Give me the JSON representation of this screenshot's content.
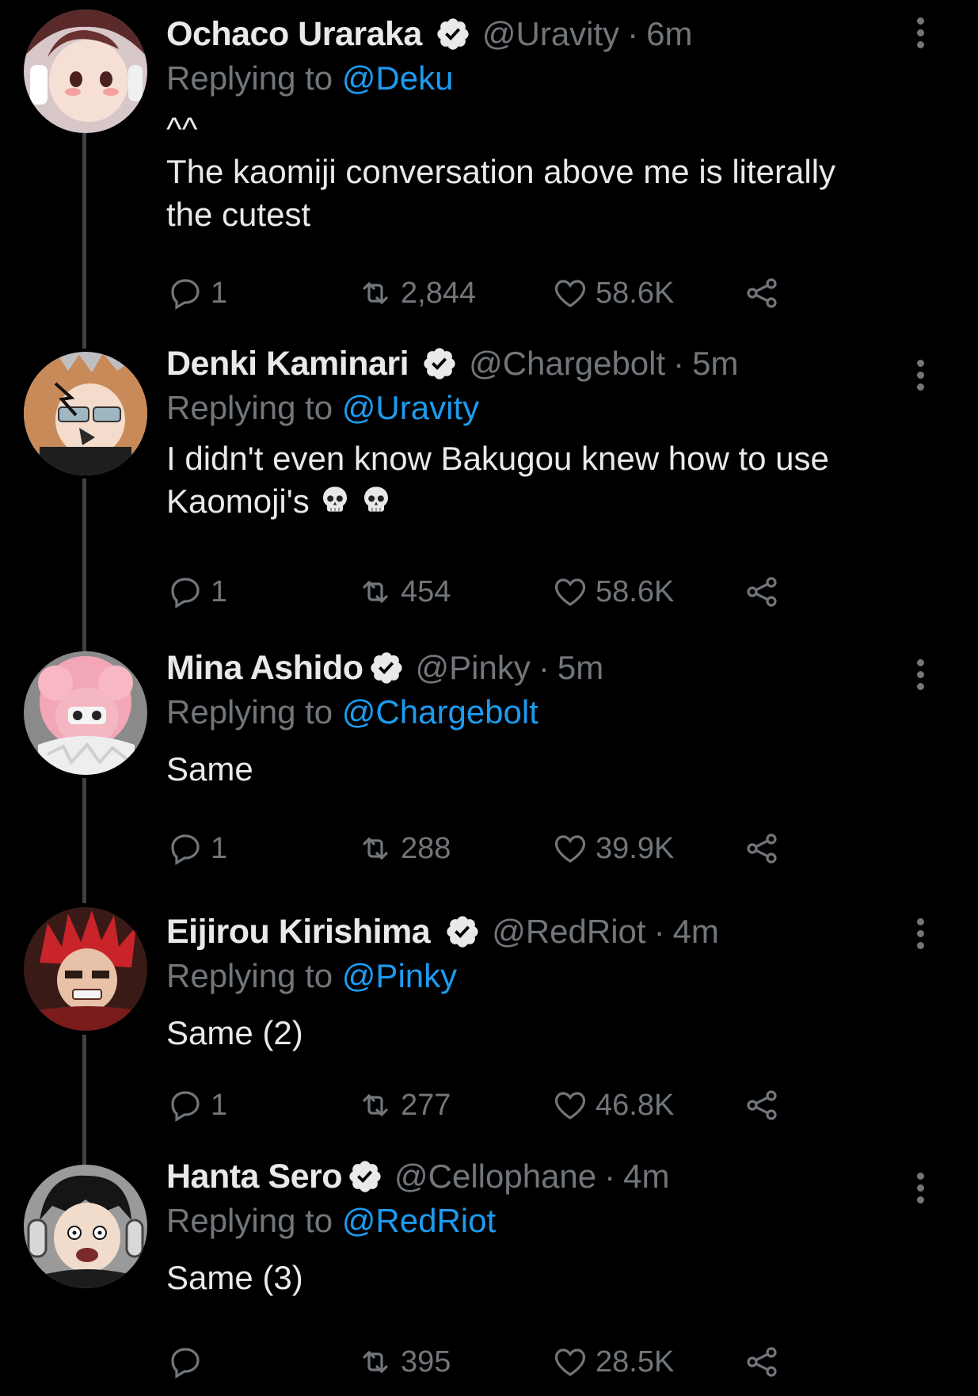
{
  "tweets": [
    {
      "name": "Ochaco Uraraka",
      "handle": "@Uravity",
      "separator": "·",
      "time": "6m",
      "replying_prefix": "Replying to ",
      "replying_to": "@Deku",
      "text_lines": [
        "^^",
        "The kaomiji conversation above me is literally",
        "the cutest"
      ],
      "replies": "1",
      "retweets": "2,844",
      "likes": "58.6K"
    },
    {
      "name": "Denki Kaminari",
      "handle": "@Chargebolt",
      "separator": "·",
      "time": "5m",
      "replying_prefix": "Replying to ",
      "replying_to": "@Uravity",
      "text_lines": [
        "I didn't even know Bakugou knew how to use",
        "Kaomoji's"
      ],
      "emoji": [
        "skull",
        "skull"
      ],
      "replies": "1",
      "retweets": "454",
      "likes": "58.6K"
    },
    {
      "name": "Mina Ashido",
      "handle": "@Pinky",
      "separator": "·",
      "time": "5m",
      "replying_prefix": "Replying to ",
      "replying_to": "@Chargebolt",
      "text_lines": [
        "Same"
      ],
      "replies": "1",
      "retweets": "288",
      "likes": "39.9K"
    },
    {
      "name": "Eijirou Kirishima",
      "handle": "@RedRiot",
      "separator": "·",
      "time": "4m",
      "replying_prefix": "Replying to ",
      "replying_to": "@Pinky",
      "text_lines": [
        "Same (2)"
      ],
      "replies": "1",
      "retweets": "277",
      "likes": "46.8K"
    },
    {
      "name": "Hanta Sero",
      "handle": "@Cellophane",
      "separator": "·",
      "time": "4m",
      "replying_prefix": "Replying to ",
      "replying_to": "@RedRiot",
      "text_lines": [
        "Same (3)"
      ],
      "replies": "",
      "retweets": "395",
      "likes": "28.5K"
    }
  ],
  "icons": {
    "verified": "verified-badge-icon",
    "more": "more-vertical-icon",
    "reply": "reply-icon",
    "retweet": "retweet-icon",
    "like": "heart-icon",
    "share": "share-icon",
    "emoji": "skull-emoji-icon"
  },
  "colors": {
    "background": "#000000",
    "text_primary": "#e7e9ea",
    "text_secondary": "#71767b",
    "link": "#1d9bf0",
    "thread_line": "#3d4147"
  }
}
